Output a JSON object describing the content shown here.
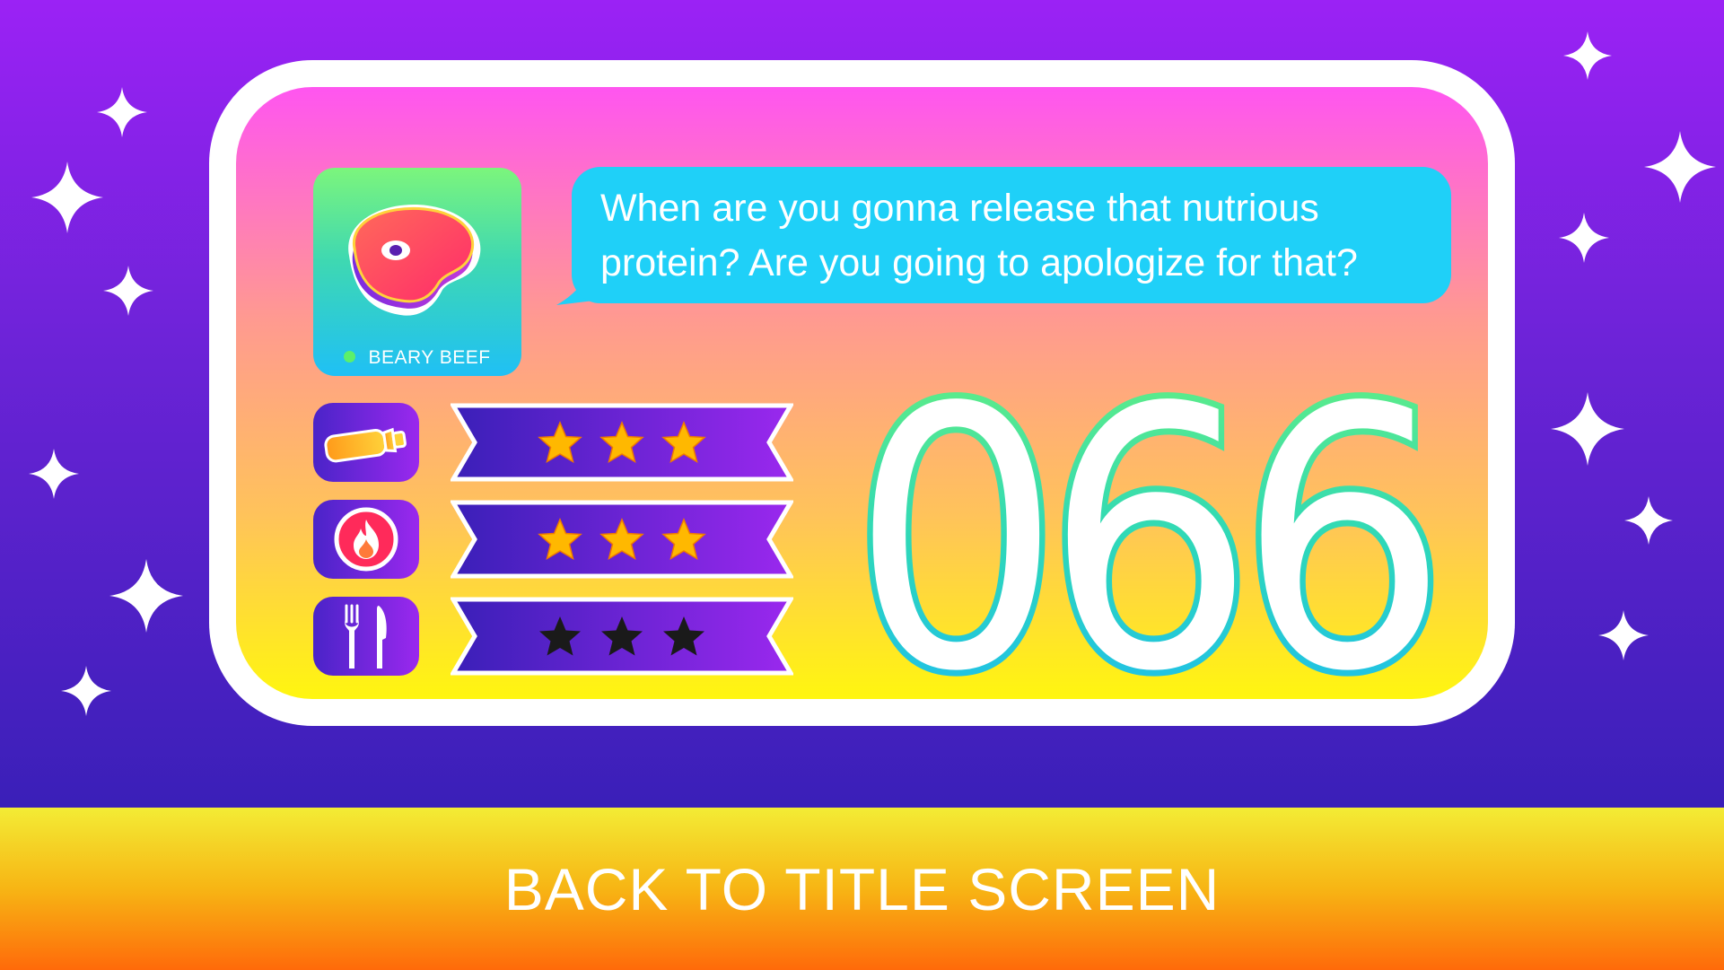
{
  "colors": {
    "background_top": "#9b22f5",
    "background_bottom": "#3a1fb8",
    "panel_border": "#ffffff",
    "bubble": "#1fd0f8",
    "star_gold": "#ffb800",
    "star_empty": "#1a1a1a",
    "button_gradient": [
      "#f3ec35",
      "#ff6a0a"
    ]
  },
  "character": {
    "name": "BEARY BEEF",
    "status": "online",
    "icon": "steak-icon"
  },
  "dialogue": {
    "message": "When are you gonna release that nutrious protein? Are you going to apologize for that?"
  },
  "ratings": [
    {
      "category_icon": "protein-bottle-icon",
      "stars_filled": 3,
      "stars_total": 3
    },
    {
      "category_icon": "fire-icon",
      "stars_filled": 3,
      "stars_total": 3
    },
    {
      "category_icon": "fork-knife-icon",
      "stars_filled": 0,
      "stars_total": 3
    }
  ],
  "score": {
    "value": "066"
  },
  "footer": {
    "back_label": "BACK TO TITLE SCREEN"
  }
}
